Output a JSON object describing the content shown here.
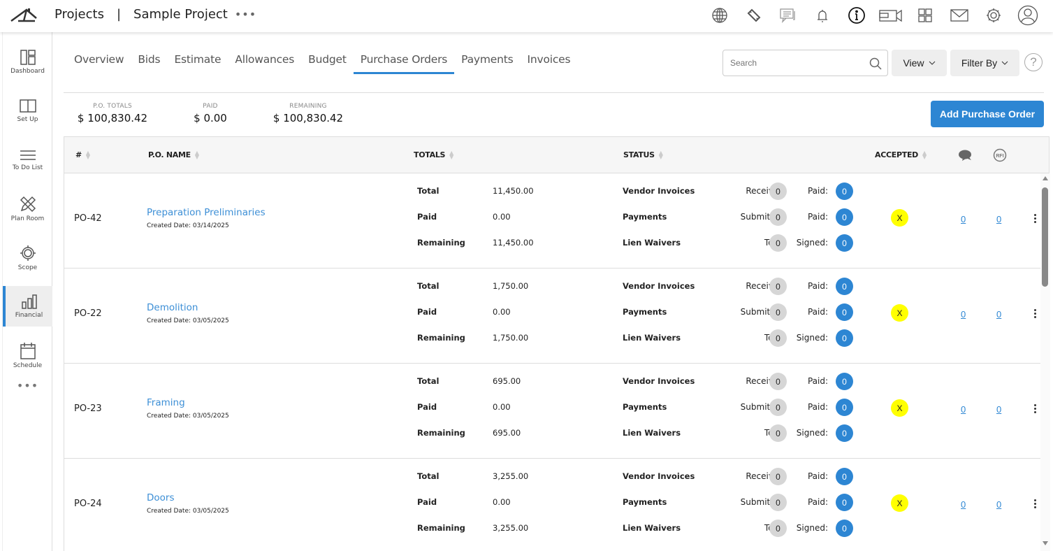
{
  "header": {
    "logo_icon": "house-roof-logo",
    "section": "Projects",
    "separator": "|",
    "project": "Sample Project",
    "more": "•••",
    "icons": [
      "globe-icon",
      "ticket-icon",
      "chat-icon",
      "bell-icon",
      "info-icon",
      "video-icon",
      "grid-icon",
      "mail-icon",
      "gear-icon",
      "user-avatar-icon"
    ]
  },
  "sidebar": {
    "items": [
      {
        "label": "Dashboard",
        "icon": "dashboard-icon"
      },
      {
        "label": "Set Up",
        "icon": "book-icon"
      },
      {
        "label": "To Do List",
        "icon": "list-icon"
      },
      {
        "label": "Plan Room",
        "icon": "pencil-ruler-icon"
      },
      {
        "label": "Scope",
        "icon": "target-icon"
      },
      {
        "label": "Financial",
        "icon": "bar-chart-icon",
        "active": true
      },
      {
        "label": "Schedule",
        "icon": "calendar-icon"
      }
    ],
    "more": "•••"
  },
  "tabs": [
    {
      "label": "Overview"
    },
    {
      "label": "Bids"
    },
    {
      "label": "Estimate"
    },
    {
      "label": "Allowances"
    },
    {
      "label": "Budget"
    },
    {
      "label": "Purchase Orders",
      "active": true
    },
    {
      "label": "Payments"
    },
    {
      "label": "Invoices"
    }
  ],
  "toolbar": {
    "search_placeholder": "Search",
    "view_label": "View",
    "filter_label": "Filter By",
    "help_label": "?",
    "add_label": "Add Purchase Order"
  },
  "summary": {
    "po_totals_label": "P.O. TOTALS",
    "po_totals": "$ 100,830.42",
    "paid_label": "PAID",
    "paid": "$ 0.00",
    "remaining_label": "REMAINING",
    "remaining": "$ 100,830.42"
  },
  "table": {
    "headers": {
      "num": "#",
      "name": "P.O. NAME",
      "totals": "TOTALS",
      "status": "STATUS",
      "accepted": "ACCEPTED"
    },
    "labels": {
      "total": "Total",
      "paid": "Paid",
      "remaining": "Remaining",
      "vendor_invoices": "Vendor Invoices",
      "payments": "Payments",
      "lien_waivers": "Lien Waivers",
      "received": "Received:",
      "paid_k": "Paid:",
      "submitted": "Submitted:",
      "total_k": "Total:",
      "signed": "Signed:",
      "created_prefix": "Created Date: "
    },
    "rows": [
      {
        "po": "PO-42",
        "name": "Preparation Preliminaries",
        "created": "Created Date: 03/14/2025",
        "total": "11,450.00",
        "paid": "0.00",
        "remaining": "11,450.00",
        "vi_received": "0",
        "vi_paid": "0",
        "pay_submitted": "0",
        "pay_paid": "0",
        "lw_total": "0",
        "lw_signed": "0",
        "accepted": "X",
        "comments": "0",
        "rfi": "0"
      },
      {
        "po": "PO-22",
        "name": "Demolition",
        "created": "Created Date: 03/05/2025",
        "total": "1,750.00",
        "paid": "0.00",
        "remaining": "1,750.00",
        "vi_received": "0",
        "vi_paid": "0",
        "pay_submitted": "0",
        "pay_paid": "0",
        "lw_total": "0",
        "lw_signed": "0",
        "accepted": "X",
        "comments": "0",
        "rfi": "0"
      },
      {
        "po": "PO-23",
        "name": "Framing",
        "created": "Created Date: 03/05/2025",
        "total": "695.00",
        "paid": "0.00",
        "remaining": "695.00",
        "vi_received": "0",
        "vi_paid": "0",
        "pay_submitted": "0",
        "pay_paid": "0",
        "lw_total": "0",
        "lw_signed": "0",
        "accepted": "X",
        "comments": "0",
        "rfi": "0"
      },
      {
        "po": "PO-24",
        "name": "Doors",
        "created": "Created Date: 03/05/2025",
        "total": "3,255.00",
        "paid": "0.00",
        "remaining": "3,255.00",
        "vi_received": "0",
        "vi_paid": "0",
        "pay_submitted": "0",
        "pay_paid": "0",
        "lw_total": "0",
        "lw_signed": "0",
        "accepted": "X",
        "comments": "0",
        "rfi": "0"
      }
    ]
  },
  "colors": {
    "accent": "#2d86d3",
    "accepted_badge": "#ffff00",
    "count_gray": "#d6d6d6"
  }
}
